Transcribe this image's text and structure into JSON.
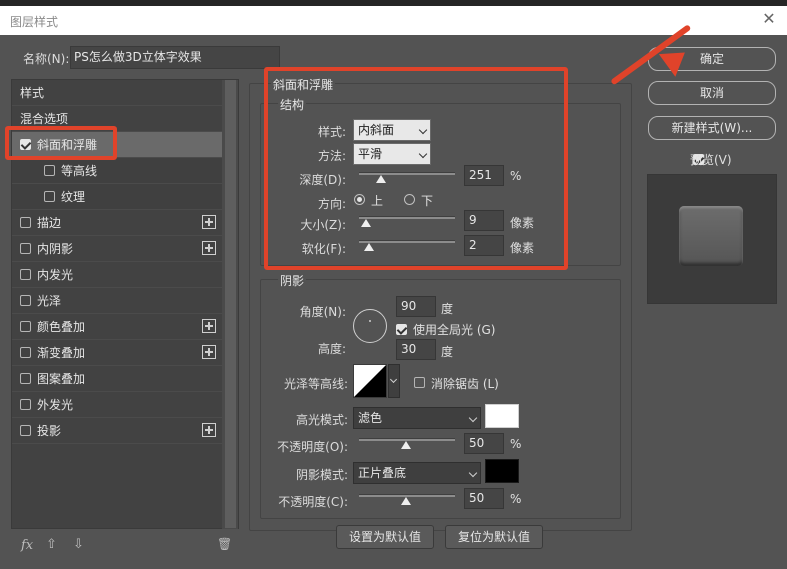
{
  "window": {
    "title": "图层样式"
  },
  "name_field": {
    "label": "名称(N):",
    "value": "PS怎么做3D立体字效果"
  },
  "left_panel": {
    "items": [
      {
        "label": "样式",
        "checkbox": false,
        "checked": false,
        "plus": false,
        "sub": false,
        "selected": false
      },
      {
        "label": "混合选项",
        "checkbox": false,
        "checked": false,
        "plus": false,
        "sub": false,
        "selected": false
      },
      {
        "label": "斜面和浮雕",
        "checkbox": true,
        "checked": true,
        "plus": false,
        "sub": false,
        "selected": true
      },
      {
        "label": "等高线",
        "checkbox": true,
        "checked": false,
        "plus": false,
        "sub": true,
        "selected": false
      },
      {
        "label": "纹理",
        "checkbox": true,
        "checked": false,
        "plus": false,
        "sub": true,
        "selected": false
      },
      {
        "label": "描边",
        "checkbox": true,
        "checked": false,
        "plus": true,
        "sub": false,
        "selected": false
      },
      {
        "label": "内阴影",
        "checkbox": true,
        "checked": false,
        "plus": true,
        "sub": false,
        "selected": false
      },
      {
        "label": "内发光",
        "checkbox": true,
        "checked": false,
        "plus": false,
        "sub": false,
        "selected": false
      },
      {
        "label": "光泽",
        "checkbox": true,
        "checked": false,
        "plus": false,
        "sub": false,
        "selected": false
      },
      {
        "label": "颜色叠加",
        "checkbox": true,
        "checked": false,
        "plus": true,
        "sub": false,
        "selected": false
      },
      {
        "label": "渐变叠加",
        "checkbox": true,
        "checked": false,
        "plus": true,
        "sub": false,
        "selected": false
      },
      {
        "label": "图案叠加",
        "checkbox": true,
        "checked": false,
        "plus": false,
        "sub": false,
        "selected": false
      },
      {
        "label": "外发光",
        "checkbox": true,
        "checked": false,
        "plus": false,
        "sub": false,
        "selected": false
      },
      {
        "label": "投影",
        "checkbox": true,
        "checked": false,
        "plus": true,
        "sub": false,
        "selected": false
      }
    ],
    "footer": {
      "fx": "fx",
      "up": "⇧",
      "down": "⇩",
      "trash": "🗑"
    }
  },
  "bevel": {
    "section_title": "斜面和浮雕",
    "structure_title": "结构",
    "style_label": "样式:",
    "style_value": "内斜面",
    "technique_label": "方法:",
    "technique_value": "平滑",
    "depth_label": "深度(D):",
    "depth_value": "251",
    "depth_unit": "%",
    "direction_label": "方向:",
    "dir_up": "上",
    "dir_down": "下",
    "size_label": "大小(Z):",
    "size_value": "9",
    "size_unit": "像素",
    "soften_label": "软化(F):",
    "soften_value": "2",
    "soften_unit": "像素"
  },
  "shading": {
    "title": "阴影",
    "angle_label": "角度(N):",
    "angle_value": "90",
    "angle_unit": "度",
    "global_light_label": "使用全局光 (G)",
    "altitude_label": "高度:",
    "altitude_value": "30",
    "altitude_unit": "度",
    "gloss_label": "光泽等高线:",
    "antialias_label": "消除锯齿 (L)",
    "highlight_mode_label": "高光模式:",
    "highlight_mode_value": "滤色",
    "highlight_opacity_label": "不透明度(O):",
    "highlight_opacity_value": "50",
    "highlight_opacity_unit": "%",
    "shadow_mode_label": "阴影模式:",
    "shadow_mode_value": "正片叠底",
    "shadow_opacity_label": "不透明度(C):",
    "shadow_opacity_value": "50",
    "shadow_opacity_unit": "%",
    "highlight_color": "#ffffff",
    "shadow_color": "#000000"
  },
  "buttons": {
    "ok": "确定",
    "cancel": "取消",
    "new_style": "新建样式(W)...",
    "preview_label": "预览(V)",
    "set_default": "设置为默认值",
    "reset_default": "复位为默认值"
  },
  "colors": {
    "annotation": "#e0432a",
    "dialog_bg": "#535353"
  }
}
